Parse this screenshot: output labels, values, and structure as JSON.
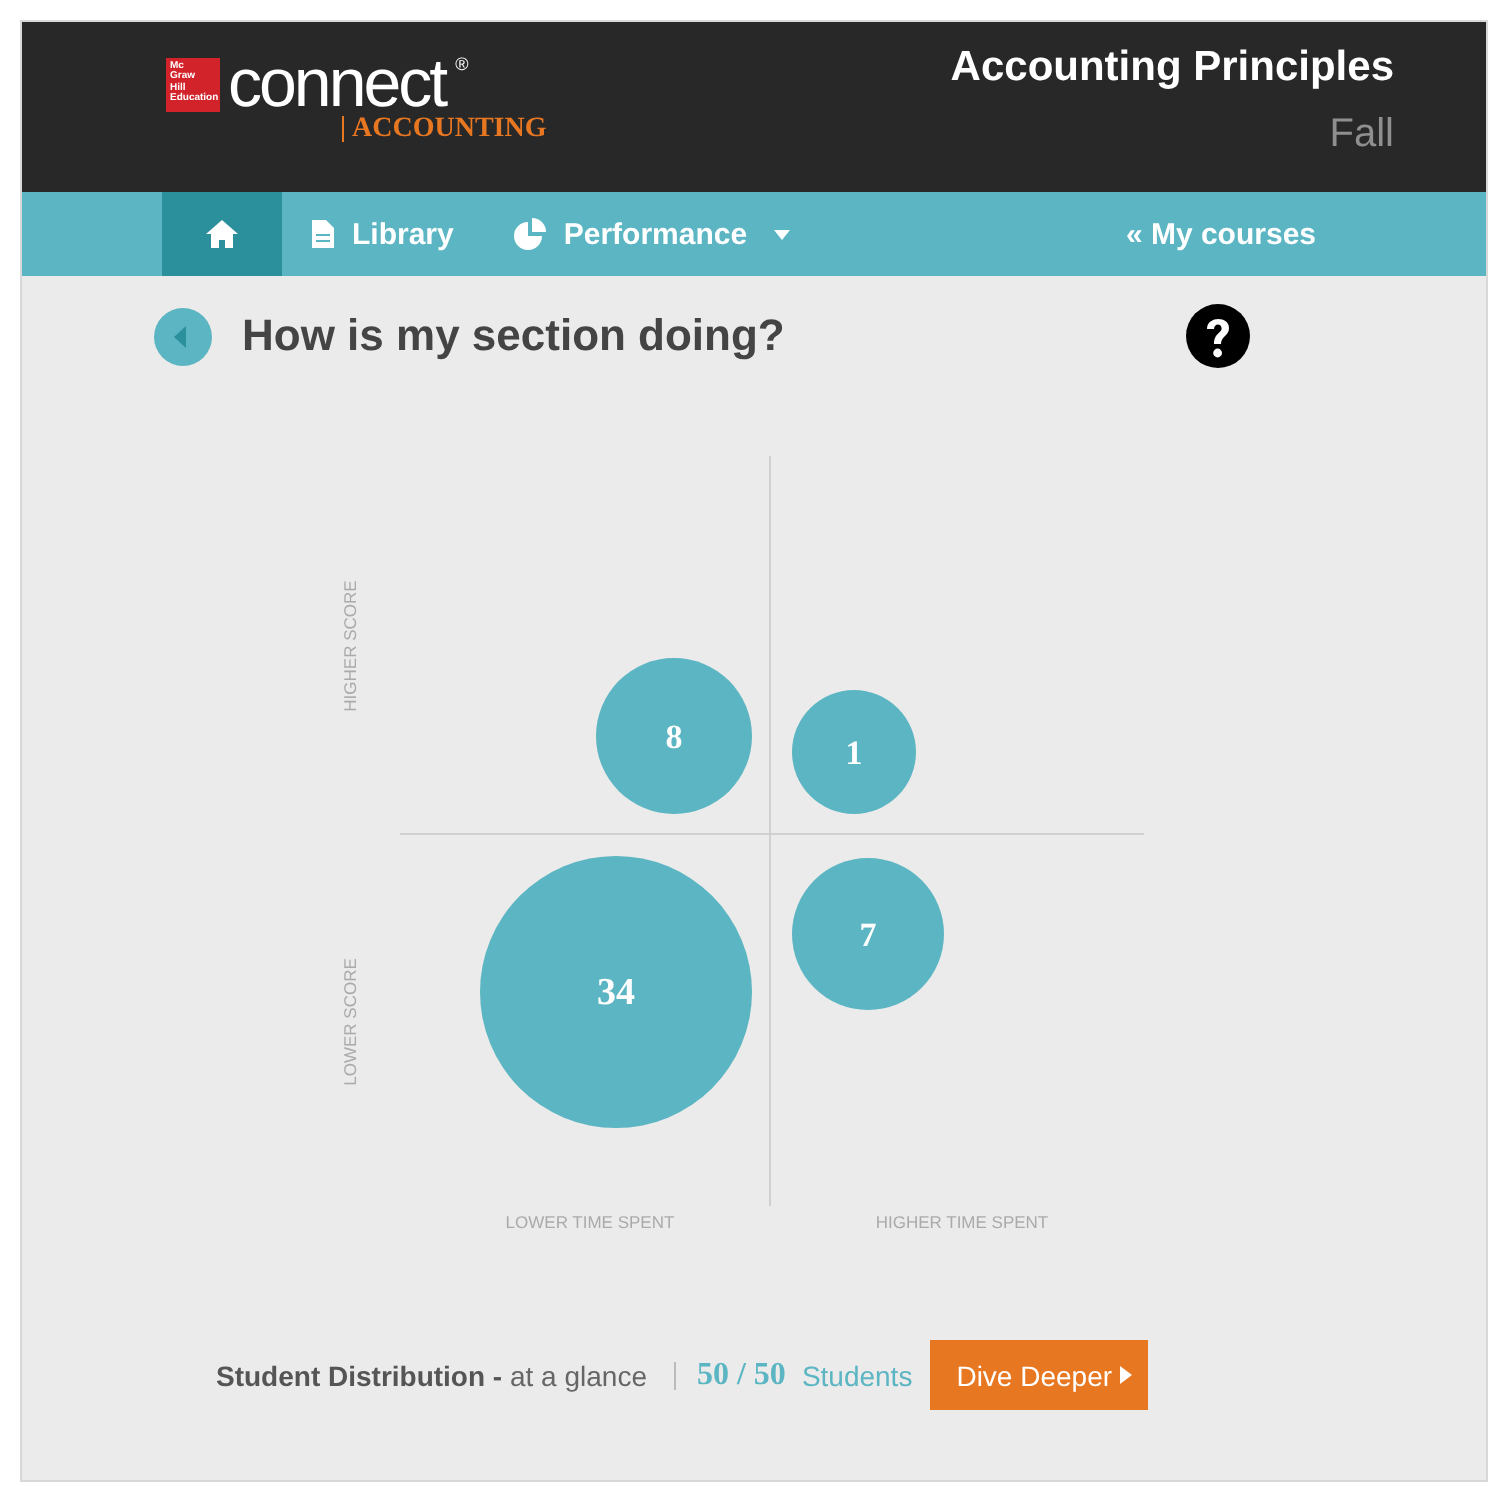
{
  "header": {
    "logo_badge": [
      "Mc",
      "Graw",
      "Hill",
      "Education"
    ],
    "brand": "connect",
    "brand_mark": "®",
    "product": "ACCOUNTING",
    "course_title": "Accounting Principles",
    "term": "Fall"
  },
  "nav": {
    "items": [
      {
        "kind": "home",
        "selected": true
      },
      {
        "kind": "library",
        "label": "Library",
        "selected": false
      },
      {
        "kind": "performance",
        "label": "Performance",
        "selected": false
      }
    ],
    "my_courses": "« My courses"
  },
  "page": {
    "title": "How is my section doing?"
  },
  "quadrant": {
    "y_labels": [
      "HIGHER SCORE",
      "LOWER SCORE"
    ],
    "x_labels": [
      "LOWER TIME SPENT",
      "HIGHER TIME SPENT"
    ],
    "bubbles": [
      {
        "kind": "topleft",
        "count": "8"
      },
      {
        "kind": "topright",
        "count": "1"
      },
      {
        "kind": "bottomleft",
        "count": "34"
      },
      {
        "kind": "bottomright",
        "count": "7"
      }
    ]
  },
  "footer": {
    "title": "Student Distribution - ",
    "subtitle": "at a glance",
    "count": "50 / 50",
    "count_label": "Students",
    "button": "Dive Deeper"
  }
}
